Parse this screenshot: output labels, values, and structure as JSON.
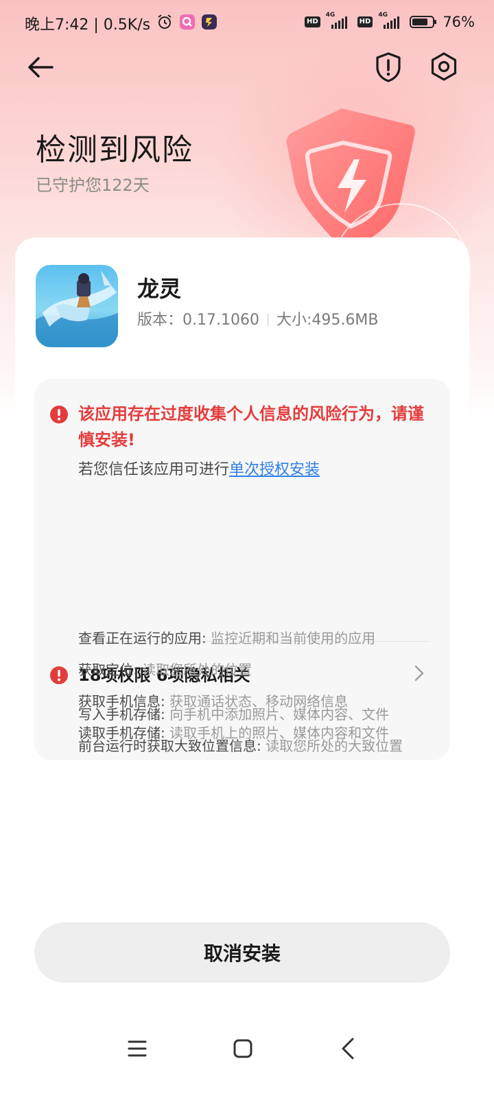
{
  "status_bar": {
    "time": "晚上7:42 | 0.5K/s",
    "hd1": "HD",
    "net1": "4G",
    "hd2": "HD",
    "net2": "4G",
    "battery_percent": "76%",
    "battery_level": 0.76
  },
  "header": {
    "title": "检测到风险",
    "subtitle": "已守护您122天"
  },
  "app": {
    "name": "龙灵",
    "version_label": "版本：",
    "version": "0.17.1060",
    "size_label": "大小:",
    "size": "495.6MB"
  },
  "risk": {
    "warning": "该应用存在过度收集个人信息的风险行为，请谨慎安装!",
    "trust_prefix": "若您信任该应用可进行",
    "trust_link": "单次授权安装"
  },
  "permissions": {
    "summary": "18项权限 6项隐私相关",
    "items": [
      {
        "name": "写入手机存储:",
        "desc": " 向手机中添加照片、媒体内容、文件"
      },
      {
        "name": "前台运行时获取大致位置信息:",
        "desc": " 读取您所处的大致位置"
      },
      {
        "name": "查看正在运行的应用:",
        "desc": " 监控近期和当前使用的应用"
      },
      {
        "name": "获取定位:",
        "desc": " 读取您所处的位置"
      },
      {
        "name": "获取手机信息:",
        "desc": " 获取通话状态、移动网络信息"
      },
      {
        "name": "读取手机存储:",
        "desc": " 读取手机上的照片、媒体内容和文件"
      }
    ]
  },
  "actions": {
    "cancel_install": "取消安装"
  },
  "colors": {
    "warning_red": "#e43c3c",
    "link_blue": "#2f7fe6",
    "hero_pink": "#fbc2c2"
  }
}
